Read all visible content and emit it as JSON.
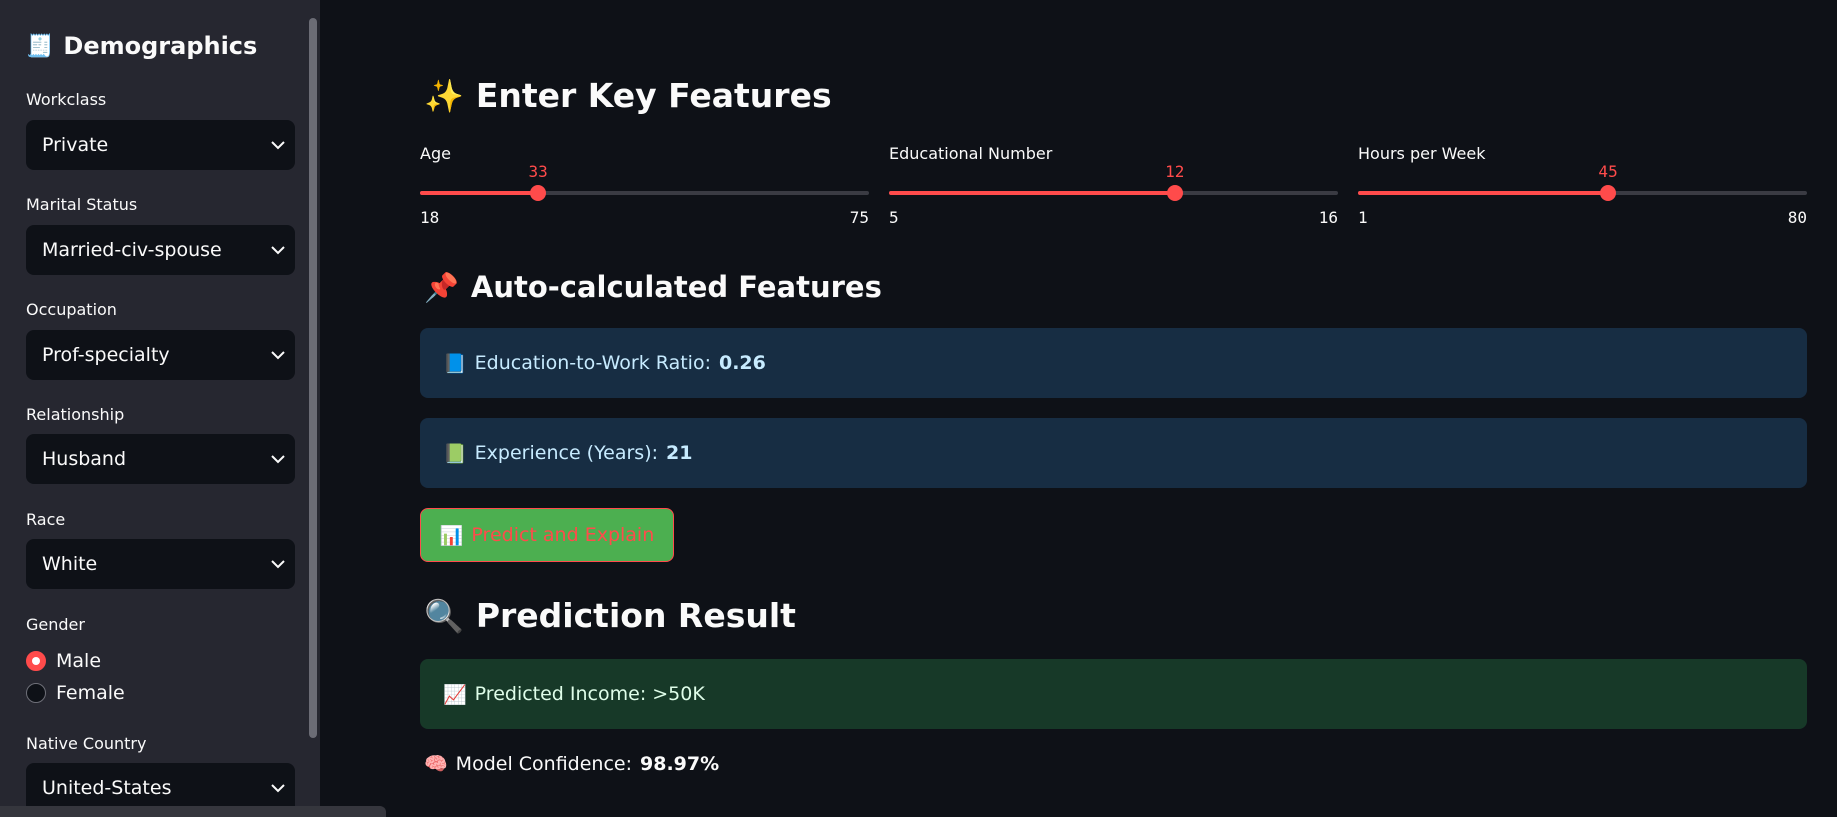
{
  "sidebar": {
    "title_icon": "🧾",
    "title": "Demographics",
    "workclass": {
      "label": "Workclass",
      "value": "Private"
    },
    "marital_status": {
      "label": "Marital Status",
      "value": "Married-civ-spouse"
    },
    "occupation": {
      "label": "Occupation",
      "value": "Prof-specialty"
    },
    "relationship": {
      "label": "Relationship",
      "value": "Husband"
    },
    "race": {
      "label": "Race",
      "value": "White"
    },
    "gender": {
      "label": "Gender",
      "options": [
        "Male",
        "Female"
      ],
      "selected": "Male"
    },
    "native_country": {
      "label": "Native Country",
      "value": "United-States"
    }
  },
  "main": {
    "key_features": {
      "icon": "✨",
      "title": "Enter Key Features"
    },
    "sliders": [
      {
        "label": "Age",
        "value": 33,
        "min": 18,
        "max": 75
      },
      {
        "label": "Educational Number",
        "value": 12,
        "min": 5,
        "max": 16
      },
      {
        "label": "Hours per Week",
        "value": 45,
        "min": 1,
        "max": 80
      }
    ],
    "auto_features": {
      "icon": "📌",
      "title": "Auto-calculated Features"
    },
    "ratio": {
      "icon": "📘",
      "label": "Education-to-Work Ratio:",
      "value": "0.26"
    },
    "experience": {
      "icon": "📗",
      "label": "Experience (Years):",
      "value": "21"
    },
    "predict_button": {
      "icon": "📊",
      "label": "Predict and Explain"
    },
    "result": {
      "icon": "🔍",
      "title": "Prediction Result"
    },
    "predicted_income": {
      "icon": "📈",
      "text": "Predicted Income: >50K"
    },
    "confidence": {
      "icon": "🧠",
      "label": "Model Confidence:",
      "value": "98.97%"
    }
  },
  "colors": {
    "accent": "#ff4b4b",
    "background": "#0e1117",
    "sidebar": "#262730",
    "info_bg": "#172d43",
    "success_bg": "#173928",
    "button_bg": "#4caf50"
  }
}
